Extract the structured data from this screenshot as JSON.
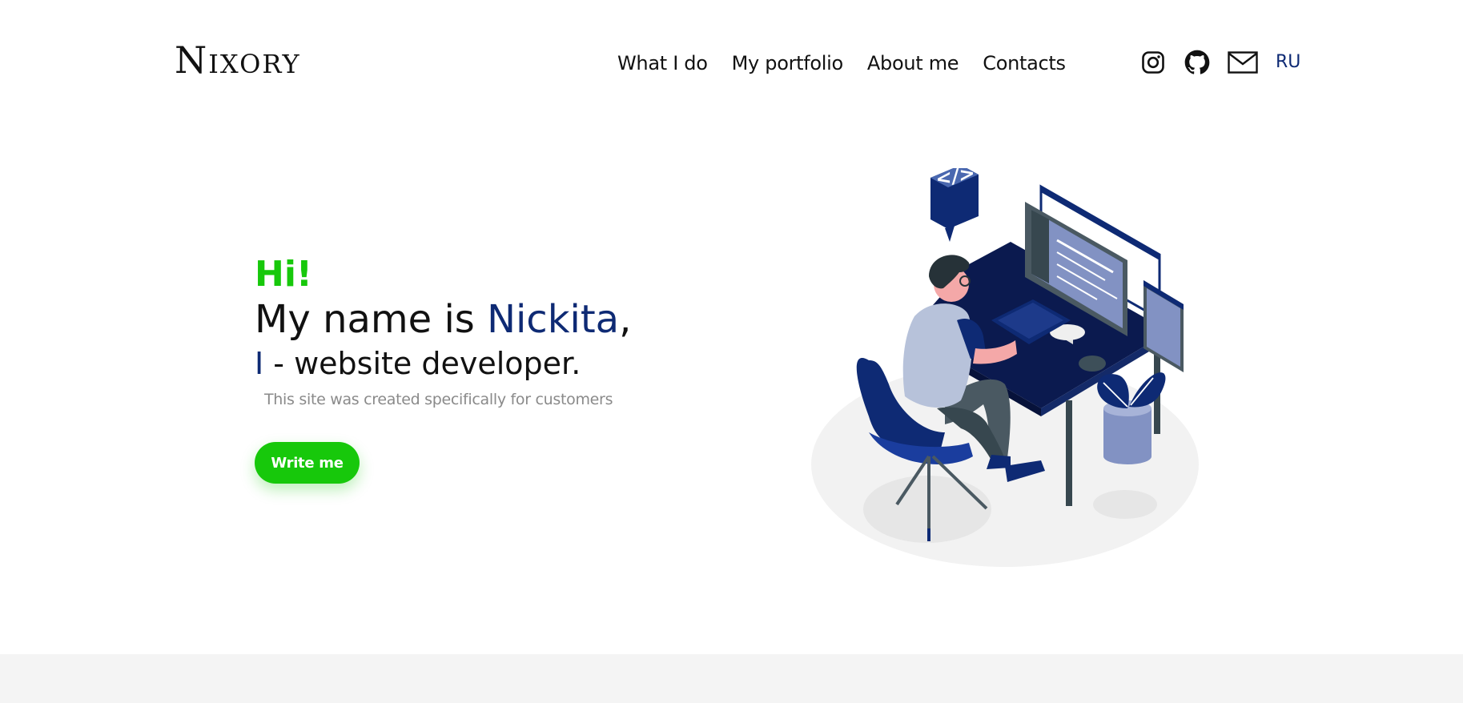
{
  "brand": {
    "logo": "Nixory"
  },
  "nav": {
    "items": [
      {
        "label": "What I do"
      },
      {
        "label": "My portfolio"
      },
      {
        "label": "About me"
      },
      {
        "label": "Contacts"
      }
    ]
  },
  "socials": {
    "icons": [
      "instagram-icon",
      "github-icon",
      "mail-icon"
    ],
    "lang": "RU"
  },
  "hero": {
    "greeting": "Hi!",
    "name_prefix": "My name is ",
    "name": "Nickita",
    "name_suffix": ",",
    "role_pronoun": "I",
    "role_text": " - website developer.",
    "subtitle": "This site was created specifically for customers",
    "cta_label": "Write me"
  },
  "colors": {
    "accent_green": "#17c80b",
    "accent_navy": "#0e2a74",
    "footer_band": "#f4f4f4"
  },
  "illustration": {
    "icon": "developer-at-desk-illustration",
    "badge": "</>"
  }
}
